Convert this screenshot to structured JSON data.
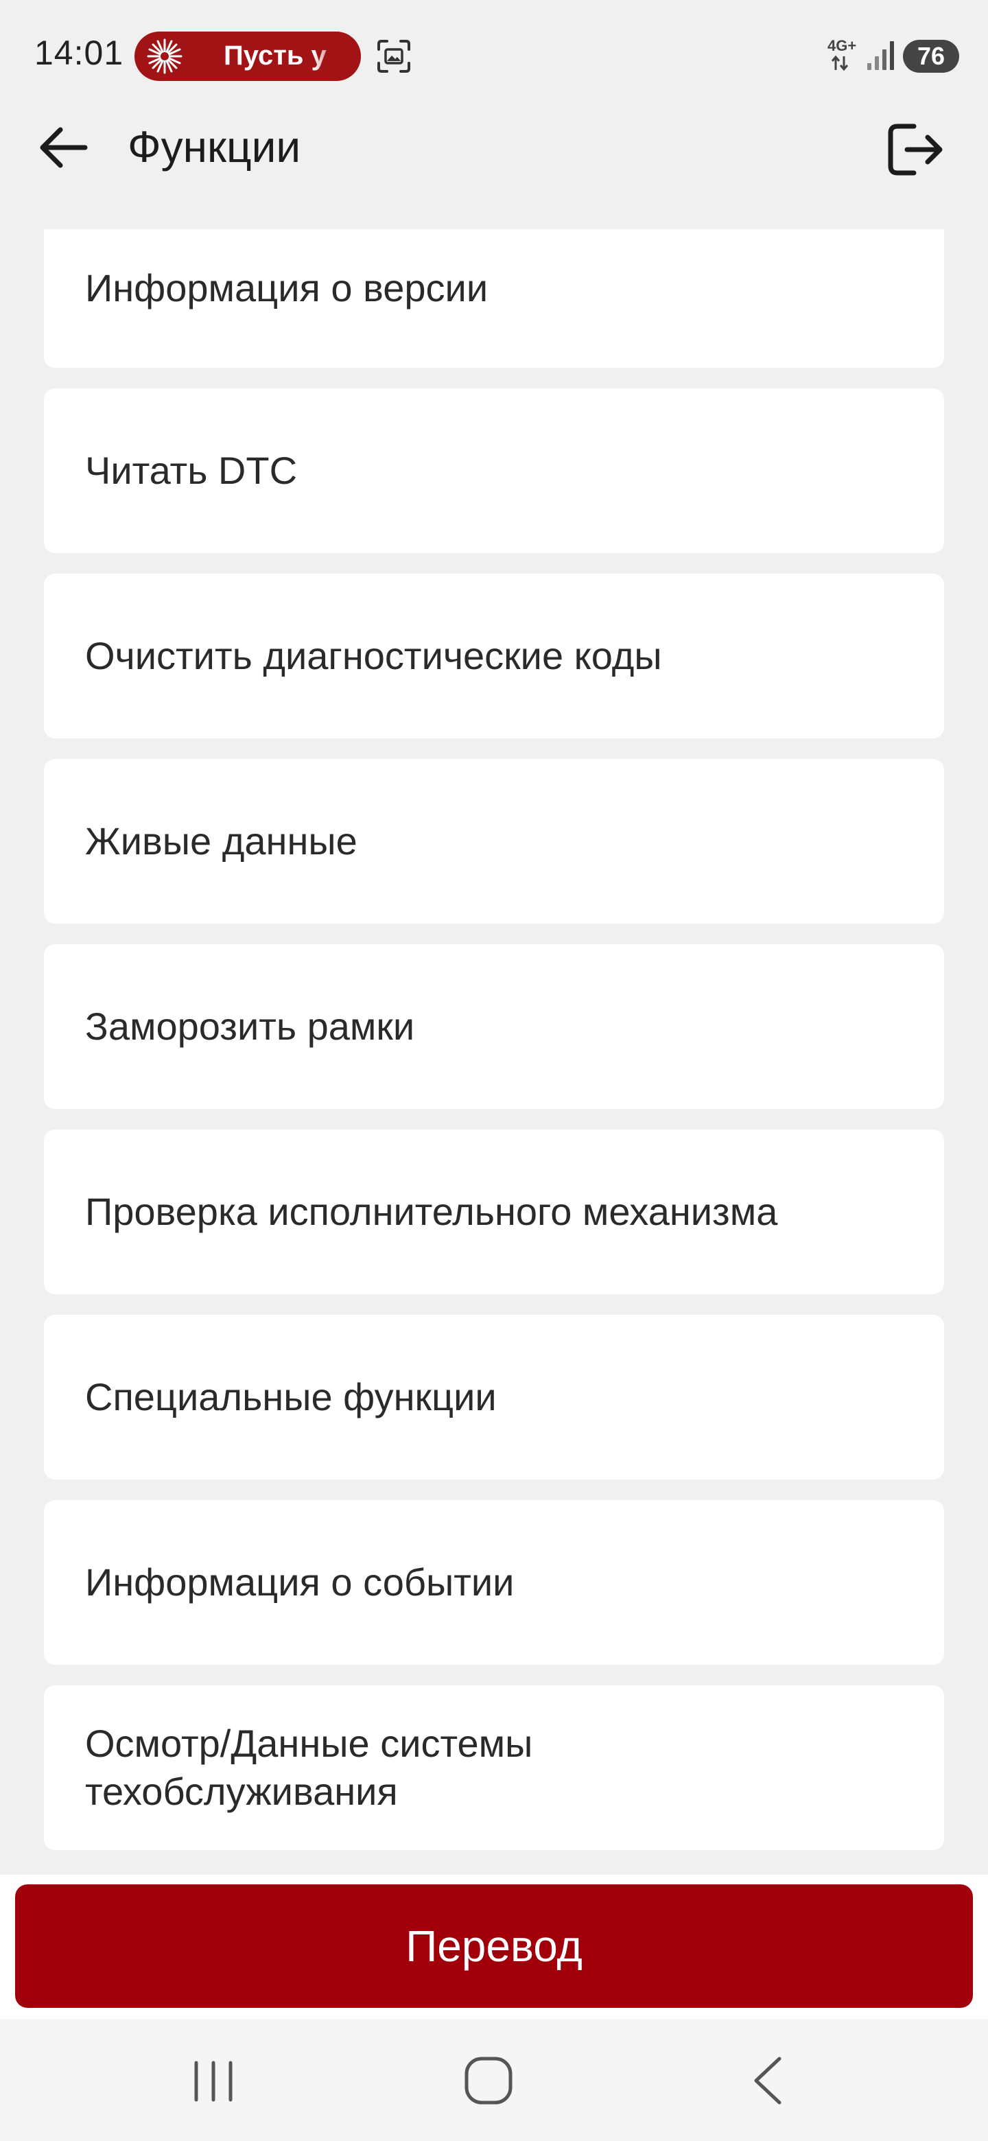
{
  "status_bar": {
    "time": "14:01",
    "notification_text": "Пусть у",
    "network_label": "4G+",
    "battery_level": "76"
  },
  "app_bar": {
    "title": "Функции"
  },
  "functions": [
    "Информация о версии",
    "Читать DTC",
    "Очистить диагностические коды",
    "Живые данные",
    "Заморозить рамки",
    "Проверка исполнительного механизма",
    "Специальные функции",
    "Информация о событии",
    "Осмотр/Данные системы\nтехобслуживания"
  ],
  "bottom_button": {
    "label": "Перевод"
  },
  "colors": {
    "accent": "#a1000a",
    "background": "#f0f0f0",
    "card": "#ffffff"
  }
}
